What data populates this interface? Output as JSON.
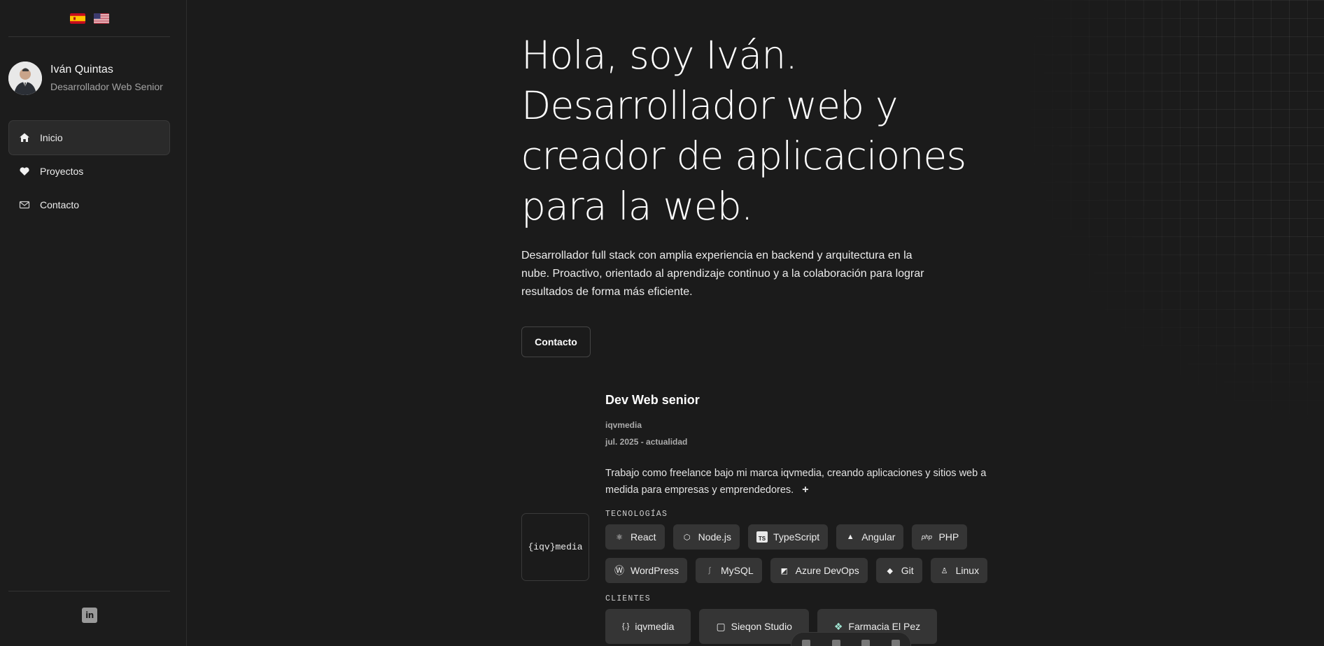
{
  "sidebar": {
    "flags": [
      {
        "name": "spanish-flag",
        "lang": "es"
      },
      {
        "name": "us-flag",
        "lang": "en"
      }
    ],
    "profile": {
      "name": "Iván Quintas",
      "role": "Desarrollador Web Senior"
    },
    "nav": [
      {
        "label": "Inicio",
        "icon": "home-icon",
        "active": true
      },
      {
        "label": "Proyectos",
        "icon": "heart-icon",
        "active": false
      },
      {
        "label": "Contacto",
        "icon": "mail-icon",
        "active": false
      }
    ],
    "social": {
      "icon": "linkedin-icon"
    }
  },
  "hero": {
    "title_lines": [
      "Hola, soy Iván.",
      "Desarrollador web y",
      "creador de aplicaciones",
      "para la web."
    ],
    "description": "Desarrollador full stack con amplia experiencia en backend y arquitectura en la nube. Proactivo, orientado al aprendizaje continuo y a la colaboración para lograr resultados de forma más eficiente.",
    "contact_button": "Contacto"
  },
  "experience": {
    "logo_text": "{iqv}media",
    "title": "Dev Web senior",
    "company": "iqvmedia",
    "dates": "jul. 2025 - actualidad",
    "description": "Trabajo como freelance bajo mi marca iqvmedia, creando aplicaciones y sitios web a medida para empresas y emprendedores.",
    "expand_label": "+",
    "technologies_label": "TECNOLOGÍAS",
    "technologies": [
      {
        "label": "React",
        "icon": "react-icon",
        "glyph": "⚛"
      },
      {
        "label": "Node.js",
        "icon": "nodejs-icon",
        "glyph": "⬡"
      },
      {
        "label": "TypeScript",
        "icon": "typescript-icon",
        "glyph": "TS"
      },
      {
        "label": "Angular",
        "icon": "angular-icon",
        "glyph": "▲"
      },
      {
        "label": "PHP",
        "icon": "php-icon",
        "glyph": "php"
      },
      {
        "label": "WordPress",
        "icon": "wordpress-icon",
        "glyph": "Ⓦ"
      },
      {
        "label": "MySQL",
        "icon": "mysql-icon",
        "glyph": "∫"
      },
      {
        "label": "Azure DevOps",
        "icon": "azure-devops-icon",
        "glyph": "◩"
      },
      {
        "label": "Git",
        "icon": "git-icon",
        "glyph": "◆"
      },
      {
        "label": "Linux",
        "icon": "linux-icon",
        "glyph": "♙"
      }
    ],
    "clients_label": "CLIENTES",
    "clients": [
      {
        "label": "iqvmedia",
        "icon": "iqvmedia-logo-icon",
        "glyph": "{.}"
      },
      {
        "label": "Sieqon Studio",
        "icon": "sieqon-logo-icon",
        "glyph": "▢"
      },
      {
        "label": "Farmacia El Pez",
        "icon": "farmacia-logo-icon",
        "glyph": "❖"
      }
    ]
  },
  "colors": {
    "background": "#1b1b1b",
    "sidebar": "#1c1c1c",
    "chip": "#353535",
    "text": "#f2f2f2",
    "muted": "#a3a3a3"
  }
}
